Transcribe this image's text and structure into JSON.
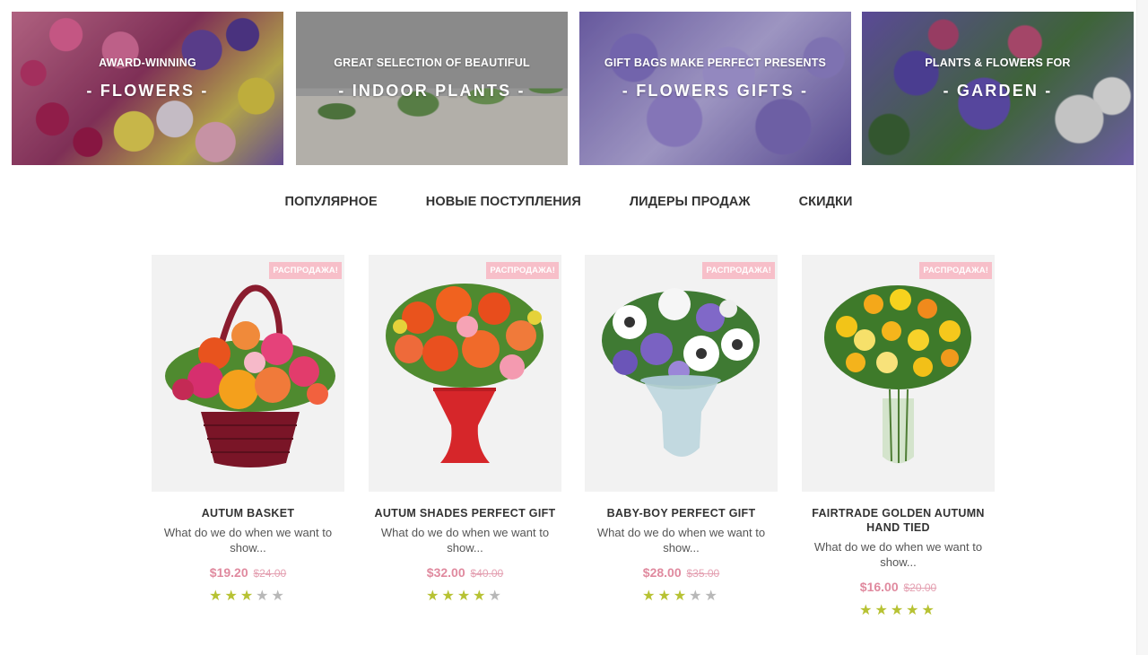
{
  "banners": [
    {
      "subtitle": "AWARD-WINNING",
      "title": "- FLOWERS -"
    },
    {
      "subtitle": "GREAT SELECTION OF BEAUTIFUL",
      "title": "- INDOOR PLANTS -"
    },
    {
      "subtitle": "GIFT BAGS MAKE PERFECT PRESENTS",
      "title": "- FLOWERS GIFTS -"
    },
    {
      "subtitle": "PLANTS & FLOWERS FOR",
      "title": "- GARDEN -"
    }
  ],
  "tabs": [
    "ПОПУЛЯРНОЕ",
    "НОВЫЕ ПОСТУПЛЕНИЯ",
    "ЛИДЕРЫ ПРОДАЖ",
    "СКИДКИ"
  ],
  "sale_badge": "РАСПРОДАЖА!",
  "star_glyph": "★",
  "colors": {
    "price": "#e08a9f",
    "badge": "#f7bfc9",
    "star_on": "#b7c233",
    "star_off": "#b8b8b8"
  },
  "products": [
    {
      "name": "AUTUM BASKET",
      "description": "What do we do when we want to show...",
      "price": "$19.20",
      "old_price": "$24.00",
      "rating": 3,
      "image": "flower-basket"
    },
    {
      "name": "AUTUM SHADES PERFECT GIFT",
      "description": "What do we do when we want to show...",
      "price": "$32.00",
      "old_price": "$40.00",
      "rating": 4,
      "image": "orange-bouquet-red-vase"
    },
    {
      "name": "BABY-BOY PERFECT GIFT",
      "description": "What do we do when we want to show...",
      "price": "$28.00",
      "old_price": "$35.00",
      "rating": 3,
      "image": "white-purple-bouquet-glass-vase"
    },
    {
      "name": "FAIRTRADE GOLDEN AUTUMN HAND TIED",
      "description": "What do we do when we want to show...",
      "price": "$16.00",
      "old_price": "$20.00",
      "rating": 5,
      "image": "yellow-roses-glass-vase"
    }
  ]
}
